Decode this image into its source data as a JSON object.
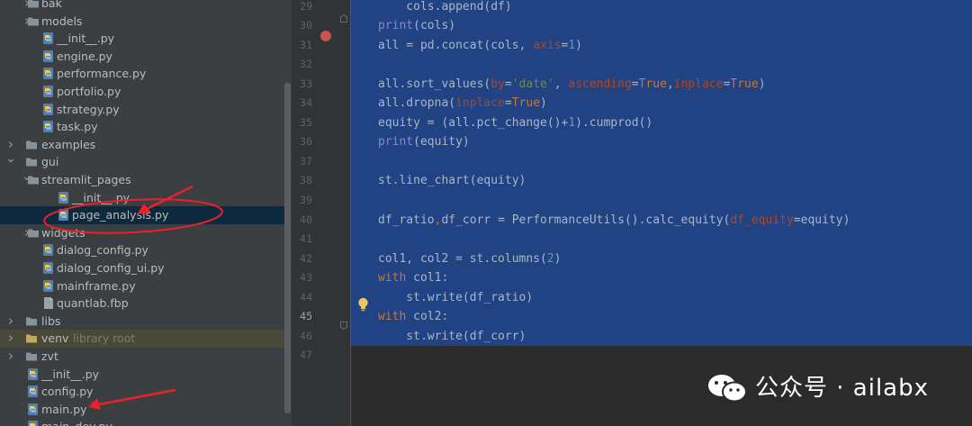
{
  "project_tree": {
    "items": [
      {
        "id": "bak",
        "label": "bak",
        "type": "folder",
        "indent": 1,
        "chevron": "right"
      },
      {
        "id": "models",
        "label": "models",
        "type": "folder",
        "indent": 1,
        "chevron": "right"
      },
      {
        "id": "init1",
        "label": "__init__.py",
        "type": "py",
        "indent": 2,
        "chevron": ""
      },
      {
        "id": "engine",
        "label": "engine.py",
        "type": "py",
        "indent": 2,
        "chevron": ""
      },
      {
        "id": "performance",
        "label": "performance.py",
        "type": "py",
        "indent": 2,
        "chevron": ""
      },
      {
        "id": "portfolio",
        "label": "portfolio.py",
        "type": "py",
        "indent": 2,
        "chevron": ""
      },
      {
        "id": "strategy",
        "label": "strategy.py",
        "type": "py",
        "indent": 2,
        "chevron": ""
      },
      {
        "id": "task",
        "label": "task.py",
        "type": "py",
        "indent": 2,
        "chevron": ""
      },
      {
        "id": "examples",
        "label": "examples",
        "type": "folder",
        "indent": 0,
        "chevron": "right"
      },
      {
        "id": "gui",
        "label": "gui",
        "type": "folder",
        "indent": 0,
        "chevron": "down"
      },
      {
        "id": "streamlit_pages",
        "label": "streamlit_pages",
        "type": "folder",
        "indent": 1,
        "chevron": "down"
      },
      {
        "id": "init2",
        "label": "__init__.py",
        "type": "py",
        "indent": 3,
        "chevron": ""
      },
      {
        "id": "page_analysis",
        "label": "page_analysis.py",
        "type": "py",
        "indent": 3,
        "chevron": "",
        "selected": true
      },
      {
        "id": "widgets",
        "label": "widgets",
        "type": "folder",
        "indent": 1,
        "chevron": "right"
      },
      {
        "id": "dialog_config",
        "label": "dialog_config.py",
        "type": "py",
        "indent": 2,
        "chevron": ""
      },
      {
        "id": "dialog_config_ui",
        "label": "dialog_config_ui.py",
        "type": "py",
        "indent": 2,
        "chevron": ""
      },
      {
        "id": "mainframe",
        "label": "mainframe.py",
        "type": "py",
        "indent": 2,
        "chevron": ""
      },
      {
        "id": "quantlab",
        "label": "quantlab.fbp",
        "type": "file",
        "indent": 2,
        "chevron": ""
      },
      {
        "id": "libs",
        "label": "libs",
        "type": "folder",
        "indent": 0,
        "chevron": "right"
      },
      {
        "id": "venv",
        "label": "venv",
        "type": "folder-venv",
        "indent": 0,
        "chevron": "right",
        "note": "library root"
      },
      {
        "id": "zvt",
        "label": "zvt",
        "type": "folder",
        "indent": 0,
        "chevron": "right"
      },
      {
        "id": "init3",
        "label": "__init__.py",
        "type": "py",
        "indent": 1,
        "chevron": ""
      },
      {
        "id": "config",
        "label": "config.py",
        "type": "py",
        "indent": 1,
        "chevron": ""
      },
      {
        "id": "main",
        "label": "main.py",
        "type": "py",
        "indent": 1,
        "chevron": ""
      },
      {
        "id": "main_dev",
        "label": "main_dev.py",
        "type": "py",
        "indent": 1,
        "chevron": ""
      }
    ]
  },
  "editor": {
    "line_numbers": [
      "29",
      "30",
      "31",
      "32",
      "33",
      "34",
      "35",
      "36",
      "37",
      "38",
      "39",
      "40",
      "41",
      "42",
      "43",
      "44",
      "45",
      "46",
      "47"
    ],
    "current_line": "45",
    "breakpoint_line": "31",
    "lines": [
      {
        "n": "29",
        "tokens": [
          {
            "t": "    cols.append(df)"
          }
        ]
      },
      {
        "n": "30",
        "tokens": [
          {
            "t": "print",
            "c": "bi"
          },
          {
            "t": "(cols)"
          }
        ]
      },
      {
        "n": "31",
        "tokens": [
          {
            "t": "all = pd.concat(cols, "
          },
          {
            "t": "axis",
            "c": "param"
          },
          {
            "t": "="
          },
          {
            "t": "1",
            "c": "num"
          },
          {
            "t": ")"
          }
        ]
      },
      {
        "n": "32",
        "tokens": []
      },
      {
        "n": "33",
        "tokens": [
          {
            "t": "all.sort_values("
          },
          {
            "t": "by",
            "c": "param"
          },
          {
            "t": "="
          },
          {
            "t": "'date'",
            "c": "str"
          },
          {
            "t": ", "
          },
          {
            "t": "ascending",
            "c": "param"
          },
          {
            "t": "="
          },
          {
            "t": "True",
            "c": "kw"
          },
          {
            "t": ","
          },
          {
            "t": "inplace",
            "c": "param"
          },
          {
            "t": "="
          },
          {
            "t": "True",
            "c": "kw"
          },
          {
            "t": ")"
          }
        ]
      },
      {
        "n": "34",
        "tokens": [
          {
            "t": "all.dropna("
          },
          {
            "t": "inplace",
            "c": "param"
          },
          {
            "t": "="
          },
          {
            "t": "True",
            "c": "kw"
          },
          {
            "t": ")"
          }
        ]
      },
      {
        "n": "35",
        "tokens": [
          {
            "t": "equity = (all.pct_change()+"
          },
          {
            "t": "1",
            "c": "num"
          },
          {
            "t": ").cumprod()"
          }
        ]
      },
      {
        "n": "36",
        "tokens": [
          {
            "t": "print",
            "c": "bi"
          },
          {
            "t": "(equity)"
          }
        ]
      },
      {
        "n": "37",
        "tokens": []
      },
      {
        "n": "38",
        "tokens": [
          {
            "t": "st.line_chart(equity)"
          }
        ]
      },
      {
        "n": "39",
        "tokens": []
      },
      {
        "n": "40",
        "tokens": [
          {
            "t": "df_ratio"
          },
          {
            "t": ",",
            "c": "kw"
          },
          {
            "t": "df_corr = PerformanceUtils().calc_equity("
          },
          {
            "t": "df_equity",
            "c": "param"
          },
          {
            "t": "=equity)"
          }
        ]
      },
      {
        "n": "41",
        "tokens": []
      },
      {
        "n": "42",
        "tokens": [
          {
            "t": "col1, col2 = st.columns("
          },
          {
            "t": "2",
            "c": "num"
          },
          {
            "t": ")"
          }
        ]
      },
      {
        "n": "43",
        "tokens": [
          {
            "t": "with ",
            "c": "kw"
          },
          {
            "t": "col1:"
          }
        ]
      },
      {
        "n": "44",
        "tokens": [
          {
            "t": "    st.write(df_ratio)"
          }
        ]
      },
      {
        "n": "45",
        "tokens": [
          {
            "t": "with ",
            "c": "kw"
          },
          {
            "t": "col2:"
          }
        ]
      },
      {
        "n": "46",
        "tokens": [
          {
            "t": "    st.write(df_corr)"
          }
        ]
      },
      {
        "n": "47",
        "tokens": []
      }
    ]
  },
  "watermark": {
    "text": "公众号 · ailabx"
  },
  "colors": {
    "selection": "#214283",
    "annotation": "#e8212b",
    "breakpoint": "#c75450",
    "sidebar_bg": "#3c3f41",
    "editor_bg": "#2b2b2b"
  }
}
